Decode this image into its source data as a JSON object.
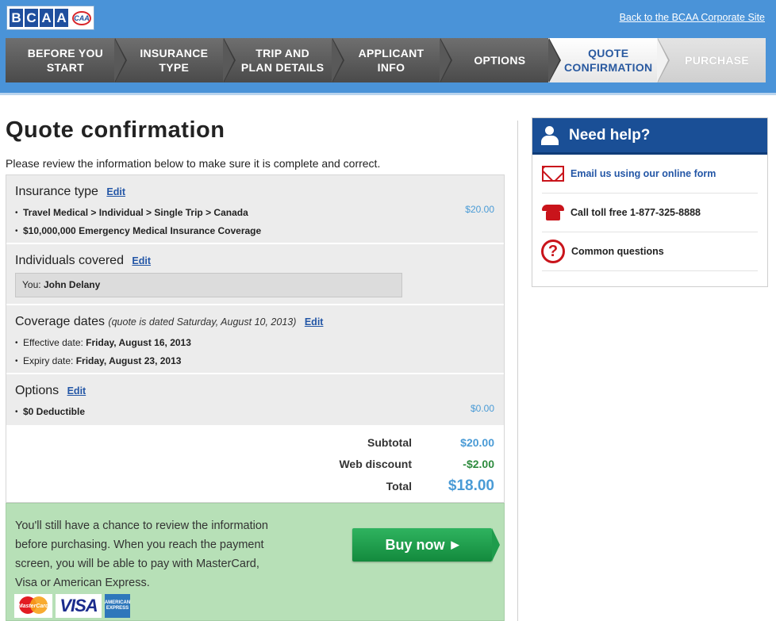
{
  "header": {
    "logo_letters": [
      "B",
      "C",
      "A",
      "A"
    ],
    "logo_badge": "CAA",
    "corporate_link": "Back to the BCAA Corporate Site"
  },
  "steps": [
    {
      "label_line1": "BEFORE YOU",
      "label_line2": "START",
      "state": "done"
    },
    {
      "label_line1": "INSURANCE",
      "label_line2": "TYPE",
      "state": "done"
    },
    {
      "label_line1": "TRIP AND",
      "label_line2": "PLAN DETAILS",
      "state": "done"
    },
    {
      "label_line1": "APPLICANT",
      "label_line2": "INFO",
      "state": "done"
    },
    {
      "label_line1": "OPTIONS",
      "label_line2": "",
      "state": "done"
    },
    {
      "label_line1": "QUOTE",
      "label_line2": "CONFIRMATION",
      "state": "active"
    },
    {
      "label_line1": "PURCHASE",
      "label_line2": "",
      "state": "upcoming"
    }
  ],
  "page": {
    "title": "Quote confirmation",
    "intro": "Please review the information below to make sure it is complete and correct."
  },
  "sections": {
    "insurance_type": {
      "heading": "Insurance type",
      "edit_label": "Edit",
      "item1": "Travel Medical > Individual > Single Trip > Canada",
      "item2": "$10,000,000 Emergency Medical Insurance Coverage",
      "price": "$20.00"
    },
    "individuals": {
      "heading": "Individuals covered",
      "edit_label": "Edit",
      "person_prefix": "You:",
      "person_name": "John Delany"
    },
    "coverage_dates": {
      "heading": "Coverage dates",
      "note": "(quote is dated Saturday, August 10, 2013)",
      "edit_label": "Edit",
      "effective_label": "Effective date:",
      "effective_value": "Friday, August 16, 2013",
      "expiry_label": "Expiry date:",
      "expiry_value": "Friday, August 23, 2013"
    },
    "options": {
      "heading": "Options",
      "edit_label": "Edit",
      "item1": "$0 Deductible",
      "price": "$0.00"
    }
  },
  "totals": {
    "subtotal_label": "Subtotal",
    "subtotal_value": "$20.00",
    "discount_label": "Web discount",
    "discount_value": "-$2.00",
    "total_label": "Total",
    "total_value": "$18.00",
    "colors": {
      "price": "#4a9bd6",
      "discount": "#2e8b3e"
    }
  },
  "purchase": {
    "message": "You'll still have a chance to review the information before purchasing. When you reach the payment screen, you will be able to pay with MasterCard, Visa or American Express.",
    "buy_label": "Buy now",
    "buy_arrow": "▶",
    "card_mastercard": "MasterCard",
    "card_visa": "VISA",
    "card_amex": "AMERICAN EXPRESS"
  },
  "help": {
    "title": "Need help?",
    "email_label": "Email us using our online form",
    "phone_label": "Call toll free 1-877-325-8888",
    "questions_label": "Common questions",
    "question_glyph": "?"
  }
}
